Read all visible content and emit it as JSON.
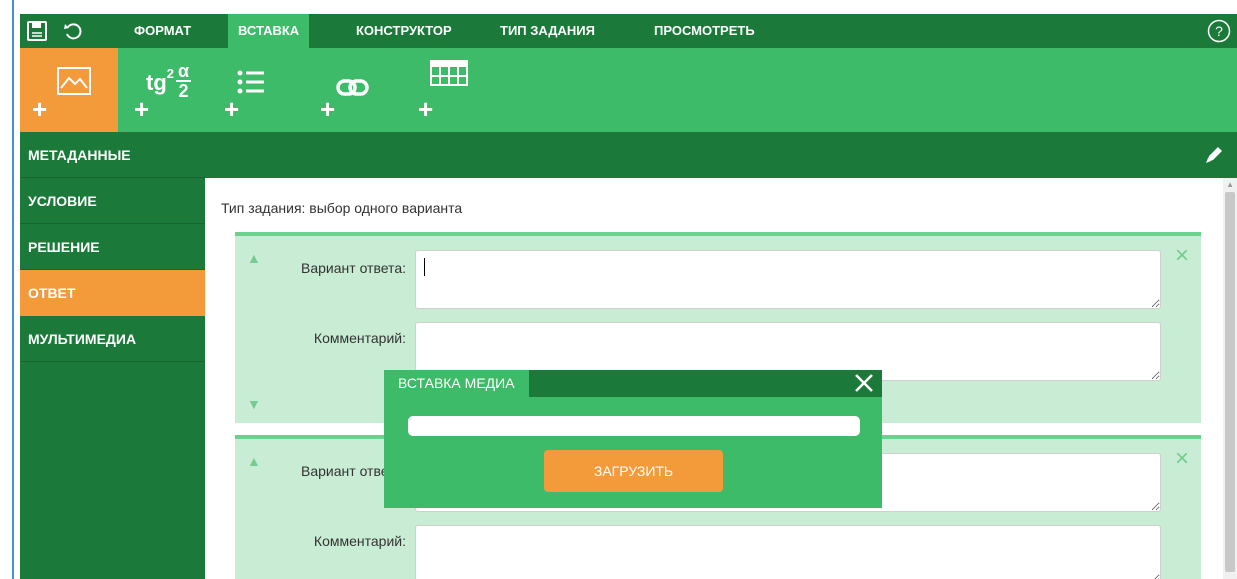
{
  "menu": {
    "tabs": [
      {
        "label": "ФОРМАТ",
        "active": false
      },
      {
        "label": "ВСТАВКА",
        "active": true
      },
      {
        "label": "КОНСТРУКТОР",
        "active": false
      },
      {
        "label": "ТИП ЗАДАНИЯ",
        "active": false
      },
      {
        "label": "ПРОСМОТРЕТЬ",
        "active": false
      }
    ],
    "icons": [
      "save-icon",
      "undo-icon",
      "help-icon"
    ]
  },
  "toolbar": {
    "buttons": [
      {
        "name": "insert-image",
        "icon": "image-icon",
        "active": true
      },
      {
        "name": "insert-formula",
        "icon": "formula-icon",
        "formula_text": "tg",
        "formula_exp": "2",
        "formula_num": "α",
        "formula_den": "2"
      },
      {
        "name": "insert-list",
        "icon": "list-icon"
      },
      {
        "name": "insert-link",
        "icon": "link-icon"
      },
      {
        "name": "insert-table",
        "icon": "table-icon"
      }
    ]
  },
  "sidebar": {
    "items": [
      {
        "label": "МЕТАДАННЫЕ",
        "active": false
      },
      {
        "label": "УСЛОВИЕ",
        "active": false
      },
      {
        "label": "РЕШЕНИЕ",
        "active": false
      },
      {
        "label": "ОТВЕТ",
        "active": true
      },
      {
        "label": "МУЛЬТИМЕДИА",
        "active": false
      }
    ]
  },
  "content": {
    "task_type": "Тип задания: выбор одного варианта",
    "cards": [
      {
        "answer_label": "Вариант ответа:",
        "answer_value": "",
        "comment_label": "Комментарий:",
        "comment_value": ""
      },
      {
        "answer_label": "Вариант ответа:",
        "answer_value": "",
        "comment_label": "Комментарий:",
        "comment_value": ""
      }
    ]
  },
  "modal": {
    "title": "ВСТАВКА МЕДИА",
    "input_value": "",
    "upload_label": "ЗАГРУЗИТЬ"
  },
  "colors": {
    "dark_green": "#1b7a3a",
    "green": "#3dbb68",
    "light_green": "#c8ecd4",
    "orange": "#f39a3b"
  }
}
